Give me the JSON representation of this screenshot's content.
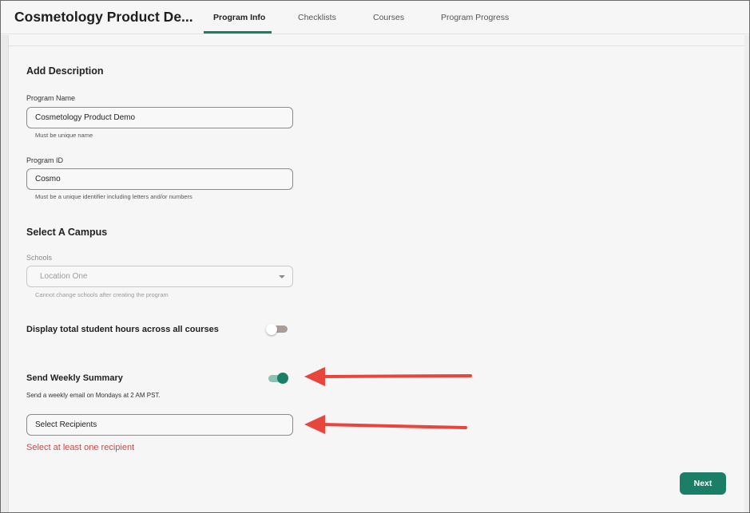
{
  "app": {
    "title": "Cosmetology Product De..."
  },
  "tabs": [
    {
      "label": "Program Info",
      "active": true
    },
    {
      "label": "Checklists",
      "active": false
    },
    {
      "label": "Courses",
      "active": false
    },
    {
      "label": "Program Progress",
      "active": false
    }
  ],
  "description": {
    "title": "Add Description",
    "program_name": {
      "label": "Program Name",
      "value": "Cosmetology Product Demo",
      "helper": "Must be unique name"
    },
    "program_id": {
      "label": "Program ID",
      "value": "Cosmo",
      "helper": "Must be a unique identifier including letters and/or numbers"
    }
  },
  "campus": {
    "title": "Select A Campus",
    "schools": {
      "label": "Schools",
      "value": "Location One",
      "helper": "Cannot change schools after creating the program",
      "disabled": true
    }
  },
  "display_hours": {
    "label": "Display total student hours across all courses",
    "enabled": false
  },
  "weekly_summary": {
    "label": "Send Weekly Summary",
    "enabled": true,
    "description": "Send a weekly email on Mondays at 2 AM PST.",
    "recipients_placeholder": "Select Recipients",
    "error": "Select at least one recipient"
  },
  "actions": {
    "next_label": "Next"
  },
  "colors": {
    "accent": "#1a7f66",
    "error": "#c54b4b",
    "annotation_arrow": "#e8453c"
  },
  "icons": {
    "dropdown": "chevron-down-icon",
    "annotation": "arrow-left-icon"
  }
}
